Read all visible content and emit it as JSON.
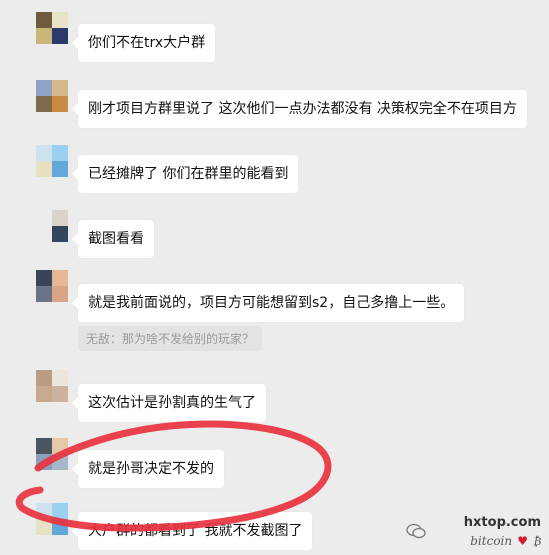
{
  "messages": [
    {
      "text": "你们不在trx大户群"
    },
    {
      "text": "刚才项目方群里说了 这次他们一点办法都没有 决策权完全不在项目方"
    },
    {
      "text": "已经摊牌了 你们在群里的能看到"
    },
    {
      "text": "截图看看"
    },
    {
      "text": "就是我前面说的，项目方可能想留到s2，自己多撸上一些。"
    },
    {
      "text": "这次估计是孙割真的生气了"
    },
    {
      "text": "就是孙哥决定不发的"
    },
    {
      "text": "大户群的都看到了 我就不发截图了"
    }
  ],
  "quote": {
    "text": "无敌：那为啥不发给别的玩家？"
  },
  "watermark": {
    "site": "hxtop.com",
    "brand": "bitcoin"
  },
  "colors": {
    "background": "#ececec",
    "bubble": "#ffffff",
    "annotation_stroke": "#e8333f"
  }
}
